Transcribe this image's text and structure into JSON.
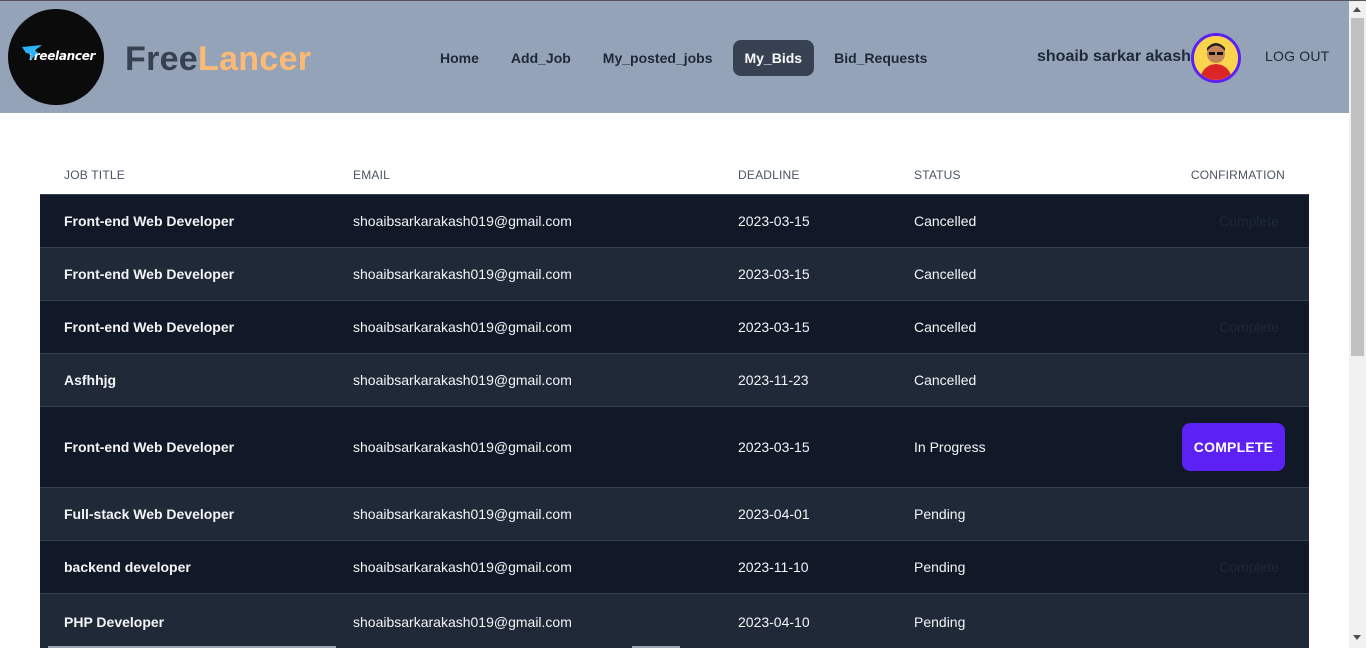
{
  "header": {
    "logo_text": "freelancer",
    "brand_part1": "Free",
    "brand_part2": "Lancer",
    "nav": [
      "Home",
      "Add_Job",
      "My_posted_jobs",
      "My_Bids",
      "Bid_Requests"
    ],
    "active_nav": "My_Bids",
    "user_name": "shoaib sarkar akash",
    "logout_label": "LOG OUT"
  },
  "table": {
    "columns": [
      "JOB TITLE",
      "EMAIL",
      "DEADLINE",
      "STATUS",
      "CONFIRMATION"
    ],
    "rows": [
      {
        "title": "Front-end Web Developer",
        "email": "shoaibsarkarakash019@gmail.com",
        "deadline": "2023-03-15",
        "status": "Cancelled",
        "confirmation": "Complete",
        "action": "ghost"
      },
      {
        "title": "Front-end Web Developer",
        "email": "shoaibsarkarakash019@gmail.com",
        "deadline": "2023-03-15",
        "status": "Cancelled",
        "confirmation": "",
        "action": "none"
      },
      {
        "title": "Front-end Web Developer",
        "email": "shoaibsarkarakash019@gmail.com",
        "deadline": "2023-03-15",
        "status": "Cancelled",
        "confirmation": "Complete",
        "action": "ghost"
      },
      {
        "title": "Asfhhjg",
        "email": "shoaibsarkarakash019@gmail.com",
        "deadline": "2023-11-23",
        "status": "Cancelled",
        "confirmation": "",
        "action": "none"
      },
      {
        "title": "Front-end Web Developer",
        "email": "shoaibsarkarakash019@gmail.com",
        "deadline": "2023-03-15",
        "status": "In Progress",
        "confirmation": "Complete",
        "action": "button"
      },
      {
        "title": "Full-stack Web Developer",
        "email": "shoaibsarkarakash019@gmail.com",
        "deadline": "2023-04-01",
        "status": "Pending",
        "confirmation": "",
        "action": "none"
      },
      {
        "title": "backend developer",
        "email": "shoaibsarkarakash019@gmail.com",
        "deadline": "2023-11-10",
        "status": "Pending",
        "confirmation": "Complete",
        "action": "ghost"
      },
      {
        "title": "PHP Developer",
        "email": "shoaibsarkarakash019@gmail.com",
        "deadline": "2023-04-10",
        "status": "Pending",
        "confirmation": "",
        "action": "none"
      }
    ]
  },
  "colors": {
    "navbar": "#94a3b8",
    "brand_accent": "#fdba74",
    "active_nav_bg": "#374151",
    "row_dark": "#111827",
    "row_light": "#1f2937",
    "complete_button": "#5b21f5"
  },
  "icons": {
    "logo": "freelancer-bird-icon",
    "avatar": "user-avatar"
  }
}
